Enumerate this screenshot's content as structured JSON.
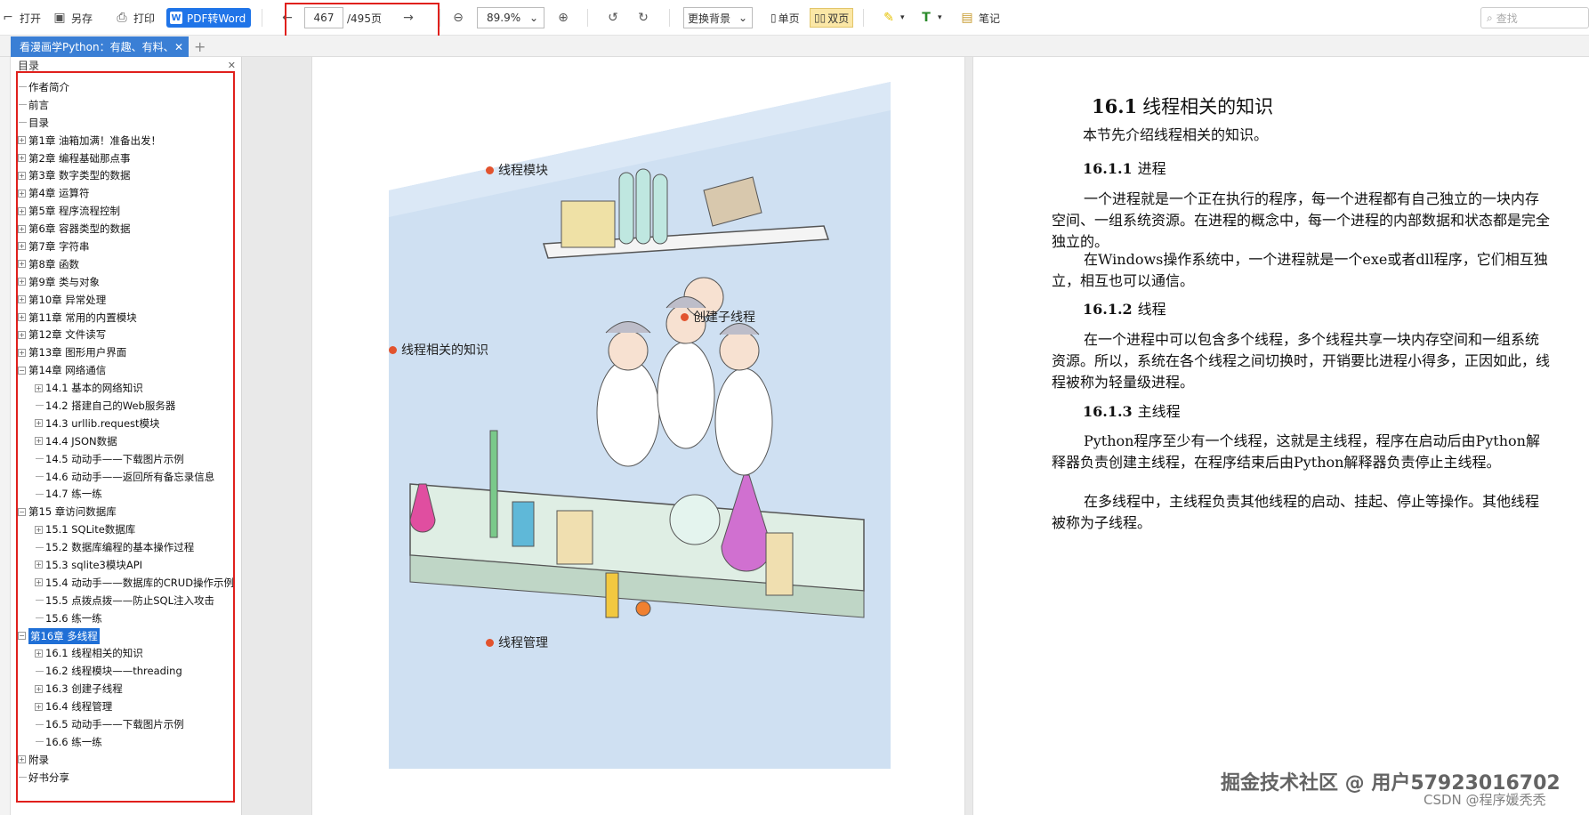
{
  "toolbar": {
    "open": "打开",
    "save_as": "另存",
    "print": "打印",
    "pdf_to_word": "PDF转Word",
    "page_current": "467",
    "page_total": "/495页",
    "zoom": "89.9%",
    "background": "更换背景",
    "single_page": "单页",
    "double_page": "双页",
    "notes": "笔记",
    "search_placeholder": "查找"
  },
  "tab": {
    "title": "看漫画学Python：有趣、有料、"
  },
  "sidebar": {
    "title": "目录",
    "items": [
      {
        "label": "作者简介",
        "level": 1,
        "expandable": false
      },
      {
        "label": "前言",
        "level": 1,
        "expandable": false
      },
      {
        "label": "目录",
        "level": 1,
        "expandable": false
      },
      {
        "label": "第1章 油箱加满！准备出发！",
        "level": 1,
        "expandable": true
      },
      {
        "label": "第2章 编程基础那点事",
        "level": 1,
        "expandable": true
      },
      {
        "label": "第3章 数字类型的数据",
        "level": 1,
        "expandable": true
      },
      {
        "label": "第4章 运算符",
        "level": 1,
        "expandable": true
      },
      {
        "label": "第5章 程序流程控制",
        "level": 1,
        "expandable": true
      },
      {
        "label": "第6章 容器类型的数据",
        "level": 1,
        "expandable": true
      },
      {
        "label": "第7章 字符串",
        "level": 1,
        "expandable": true
      },
      {
        "label": "第8章 函数",
        "level": 1,
        "expandable": true
      },
      {
        "label": "第9章 类与对象",
        "level": 1,
        "expandable": true
      },
      {
        "label": "第10章 异常处理",
        "level": 1,
        "expandable": true
      },
      {
        "label": "第11章 常用的内置模块",
        "level": 1,
        "expandable": true
      },
      {
        "label": "第12章 文件读写",
        "level": 1,
        "expandable": true
      },
      {
        "label": "第13章 图形用户界面",
        "level": 1,
        "expandable": true
      },
      {
        "label": "第14章 网络通信",
        "level": 1,
        "expandable": true,
        "expanded": true
      },
      {
        "label": "14.1 基本的网络知识",
        "level": 2,
        "expandable": true
      },
      {
        "label": "14.2 搭建自己的Web服务器",
        "level": 2,
        "expandable": false
      },
      {
        "label": "14.3 urllib.request模块",
        "level": 2,
        "expandable": true
      },
      {
        "label": "14.4 JSON数据",
        "level": 2,
        "expandable": true
      },
      {
        "label": "14.5 动动手——下载图片示例",
        "level": 2,
        "expandable": false
      },
      {
        "label": "14.6 动动手——返回所有备忘录信息",
        "level": 2,
        "expandable": false
      },
      {
        "label": "14.7 练一练",
        "level": 2,
        "expandable": false
      },
      {
        "label": "第15 章访问数据库",
        "level": 1,
        "expandable": true,
        "expanded": true
      },
      {
        "label": "15.1 SQLite数据库",
        "level": 2,
        "expandable": true
      },
      {
        "label": "15.2 数据库编程的基本操作过程",
        "level": 2,
        "expandable": false
      },
      {
        "label": "15.3 sqlite3模块API",
        "level": 2,
        "expandable": true
      },
      {
        "label": "15.4 动动手——数据库的CRUD操作示例",
        "level": 2,
        "expandable": true
      },
      {
        "label": "15.5 点拨点拨——防止SQL注入攻击",
        "level": 2,
        "expandable": false
      },
      {
        "label": "15.6 练一练",
        "level": 2,
        "expandable": false
      },
      {
        "label": "第16章 多线程",
        "level": 1,
        "expandable": true,
        "expanded": true,
        "selected": true
      },
      {
        "label": "16.1 线程相关的知识",
        "level": 2,
        "expandable": true
      },
      {
        "label": "16.2 线程模块——threading",
        "level": 2,
        "expandable": false
      },
      {
        "label": "16.3 创建子线程",
        "level": 2,
        "expandable": true
      },
      {
        "label": "16.4 线程管理",
        "level": 2,
        "expandable": true
      },
      {
        "label": "16.5 动动手——下载图片示例",
        "level": 2,
        "expandable": false
      },
      {
        "label": "16.6 练一练",
        "level": 2,
        "expandable": false
      },
      {
        "label": "附录",
        "level": 1,
        "expandable": true
      },
      {
        "label": "好书分享",
        "level": 1,
        "expandable": false
      }
    ]
  },
  "left_page": {
    "labels": {
      "thread_module": "线程模块",
      "create_thread": "创建子线程",
      "thread_knowledge": "线程相关的知识",
      "thread_management": "线程管理"
    }
  },
  "right_page": {
    "heading_num": "16.1",
    "heading_text": "线程相关的知识",
    "intro": "本节先介绍线程相关的知识。",
    "s1_num": "16.1.1",
    "s1_title": "进程",
    "s1_p1": "一个进程就是一个正在执行的程序，每一个进程都有自己独立的一块内存空间、一组系统资源。在进程的概念中，每一个进程的内部数据和状态都是完全独立的。",
    "s1_p2": "在Windows操作系统中，一个进程就是一个exe或者dll程序，它们相互独立，相互也可以通信。",
    "s2_num": "16.1.2",
    "s2_title": "线程",
    "s2_p1": "在一个进程中可以包含多个线程，多个线程共享一块内存空间和一组系统资源。所以，系统在各个线程之间切换时，开销要比进程小得多，正因如此，线程被称为轻量级进程。",
    "s3_num": "16.1.3",
    "s3_title": "主线程",
    "s3_p1": "Python程序至少有一个线程，这就是主线程，程序在启动后由Python解释器负责创建主线程，在程序结束后由Python解释器负责停止主线程。",
    "s3_p2": "在多线程中，主线程负责其他线程的启动、挂起、停止等操作。其他线程被称为子线程。"
  },
  "watermark": "掘金技术社区 @ 用户57923016702",
  "csdn": "CSDN @程序媛秃秃",
  "colors": {
    "accent": "#1f74e8",
    "highlight_box": "#e0201c",
    "selection": "#1f6fd6"
  }
}
